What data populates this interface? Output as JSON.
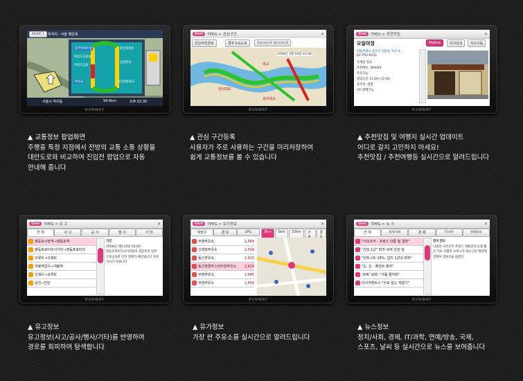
{
  "brand": "RUNWAY",
  "panels": [
    {
      "id": "traffic-popup",
      "caption": [
        "▲ 교통정보 팝업화면",
        "주행중 특정 지점에서 전방의 교통 소통 상황을",
        "대안도로와 비교하여 진입전 팝업으로 자동",
        "안내해 줍니다"
      ],
      "screen": {
        "mode": "MODE 1",
        "route": "목적지 : 서울 해운대",
        "labels": [
          "동부아파트앞",
          "여의도공원앞",
          "여의도공원",
          "중앙대정문",
          "삼성본관",
          "여의교",
          "당산양화대교"
        ],
        "bottom_location": "서울시 여의동",
        "bottom_distance": "94.6km",
        "time": "오후 02:30"
      }
    },
    {
      "id": "interest-route",
      "caption": [
        "▲ 관심 구간등록",
        "사용자가 주로 사용하는 구간을 미리저장하여",
        "쉽게 교통정보를 볼 수 있습니다"
      ],
      "screen": {
        "logo": "Gini",
        "crumb": "TPEG > 관심구간",
        "tabs": [
          "한강주변경로",
          "경부고속도로",
          "경부고속도로 경인고속도로"
        ],
        "info": "2008년 3월 10일 14:00",
        "places": [
          "대교",
          "한남대교",
          "성수대교"
        ]
      }
    },
    {
      "id": "restaurant",
      "caption": [
        "▲ 추천맛집 및 여행지 실시간 업데이트",
        "어디로 갈지 고민하지 마세요!",
        "추천맛집 / 추천여행등 실시간으로 알려드립니다"
      ],
      "screen": {
        "logo": "Gini",
        "crumb": "TPEG > 추천맛집",
        "name": "오일여정",
        "mybox": "MyBox",
        "save": "비교안내",
        "map": "지도이동",
        "address": "서울특별시 용산구 한남동 737-2",
        "phone": "02-792-6541",
        "items": [
          "옥계천 정식",
          "추천메뉴: W9000",
          "주차가능",
          "영업시간 11:00~22:00",
          "휴무일: 명절",
          "카드결제가능"
        ]
      }
    },
    {
      "id": "incident",
      "caption": [
        "▲ 유고정보",
        "유고정보(사고/공사/행사/기타)를 반영하여",
        "경로를 회피하여 탐색합니다"
      ],
      "screen": {
        "logo": "Gini",
        "crumb": "TPEG > 유 고",
        "tabs": [
          "전 체",
          "사 고",
          "공 사",
          "행 사",
          "기 타"
        ],
        "list": [
          "영등포시장역→영등포역",
          "영등포로터리사거리→영등포로터리",
          "오류IC→구로IC",
          "개봉역입구→개봉역",
          "신월IC→오류IC",
          "순천→전안"
        ],
        "detail_title": "기간",
        "detail_date": "2008년 3월 10일 00:00",
        "detail_text": "영등포로터리사거리에서 영등포역 방면 도로공사로 인한 정체가 예상됩니다 우회하시기 바랍니다"
      }
    },
    {
      "id": "fuel",
      "caption": [
        "▲ 유가정보",
        "가장 싼 주유소를 실시간으로 알려드립니다"
      ],
      "screen": {
        "logo": "Gini",
        "crumb": "TPEG > 유가정보",
        "tabs": [
          "휘발유",
          "경 유",
          "LPG"
        ],
        "dist": [
          "3km",
          "5km",
          "10km",
          "가격순",
          "경유"
        ],
        "stations": [
          {
            "name": "부영주유소",
            "price": "1,589"
          },
          {
            "name": "신대방주유소",
            "price": "1,599"
          },
          {
            "name": "동신주유소",
            "price": "1,610"
          },
          {
            "name": "동신명경부스타타임주유소",
            "price": "1,629"
          },
          {
            "name": "부영주유소",
            "price": "1,645"
          },
          {
            "name": "부영주유소",
            "price": "1,656"
          }
        ]
      }
    },
    {
      "id": "news",
      "caption": [
        "▲ 뉴스정보",
        "정치/사회, 경제, IT/과학, 연예/방송, 국제,",
        "스포츠, 날씨 등 실시간으로 뉴스를 보여줍니다"
      ],
      "screen": {
        "logo": "Gini",
        "crumb": "TPEG > 뉴 스",
        "tabs": [
          "전 체",
          "정치/사회",
          "경 제",
          "IT/과학",
          "연예/방송"
        ],
        "headlines": [
          "\"사모조카 - 프랑스 대통 될 결혼\"",
          "\"건당 1년\" 파라 세계 건강 설",
          "\"산토시트 28%, 입지 1년내 최저\"",
          "\"손, 손 - 플린트 플러\"",
          "'보배' 보배, \"가몸 몰아와\"",
          "이사카벤트스 \"수표 없는 자장기\""
        ],
        "detail_title": "영국 연도",
        "detail_text": "니콜라 사르코지 프랑스 대통령과 모델 출신 가수 카를라 브루니가 지난 2일 엘리제궁에서 결혼식을 올렸다"
      }
    }
  ]
}
